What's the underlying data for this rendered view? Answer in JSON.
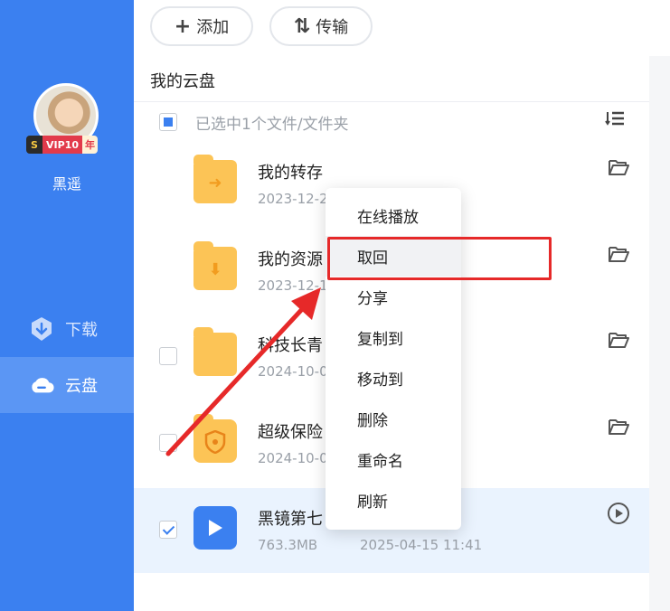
{
  "sidebar": {
    "username": "黑遥",
    "vip_badge": {
      "s": "S",
      "label": "VIP10",
      "suffix": "年"
    },
    "nav": [
      {
        "label": "下载",
        "icon": "download-shield-icon"
      },
      {
        "label": "云盘",
        "icon": "cloud-icon"
      }
    ]
  },
  "toolbar": {
    "add_label": "添加",
    "transfer_label": "传输"
  },
  "breadcrumb": "我的云盘",
  "selection": {
    "text": "已选中1个文件/文件夹"
  },
  "files": [
    {
      "name": "我的转存",
      "meta": "2023-12-2"
    },
    {
      "name": "我的资源",
      "meta": "2023-12-1"
    },
    {
      "name": "科技长青",
      "meta": "2024-10-0"
    },
    {
      "name": "超级保险",
      "meta": "2024-10-0"
    },
    {
      "name": "黑镜第七",
      "size": "763.3MB",
      "date": "2025-04-15 11:41"
    }
  ],
  "context_menu": {
    "items": [
      "在线播放",
      "取回",
      "分享",
      "复制到",
      "移动到",
      "删除",
      "重命名",
      "刷新"
    ]
  },
  "colors": {
    "sidebar": "#3b80f0",
    "annotation": "#e62929",
    "folder": "#fcc456",
    "selected_row": "#eaf3fe"
  }
}
